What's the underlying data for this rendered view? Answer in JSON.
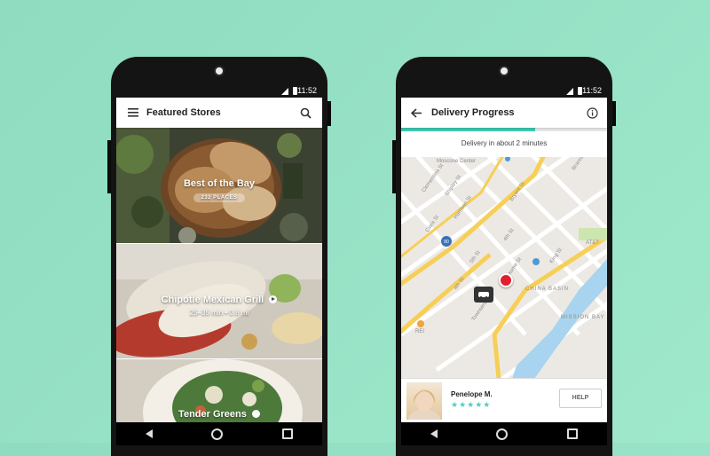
{
  "status_bar": {
    "time": "11:52"
  },
  "featured": {
    "title": "Featured Stores",
    "stores": [
      {
        "name": "Best of the Bay",
        "badge": "232 PLACES"
      },
      {
        "name": "Chipotle Mexican Grill",
        "meta": "25–35 min • 0.8 mi"
      },
      {
        "name": "Tender Greens"
      }
    ]
  },
  "delivery": {
    "title": "Delivery Progress",
    "banner": "Delivery in about 2 minutes",
    "progress": 0.65,
    "courier": {
      "name": "Penelope M.",
      "rating": 5
    },
    "help_label": "HELP",
    "map_labels": {
      "moscone": "Moscone Center",
      "bryant": "Bryant St",
      "king": "King St",
      "fourth": "4th St",
      "fifth": "5th St",
      "harrison": "Harrison St",
      "clementina": "Clementina St",
      "shipley": "Shipley St",
      "clara": "Clara St",
      "brannan": "Brannan St",
      "townsend": "Townsend St",
      "bluxome": "Bluxome St",
      "china_basin": "CHINA BASIN",
      "mission_bay": "MISSION BAY",
      "rei": "REI",
      "i80": "80",
      "att": "AT&T"
    }
  },
  "colors": {
    "accent": "#3ec6b0",
    "pin": "#e0202f",
    "background": "#9fe3c6"
  }
}
